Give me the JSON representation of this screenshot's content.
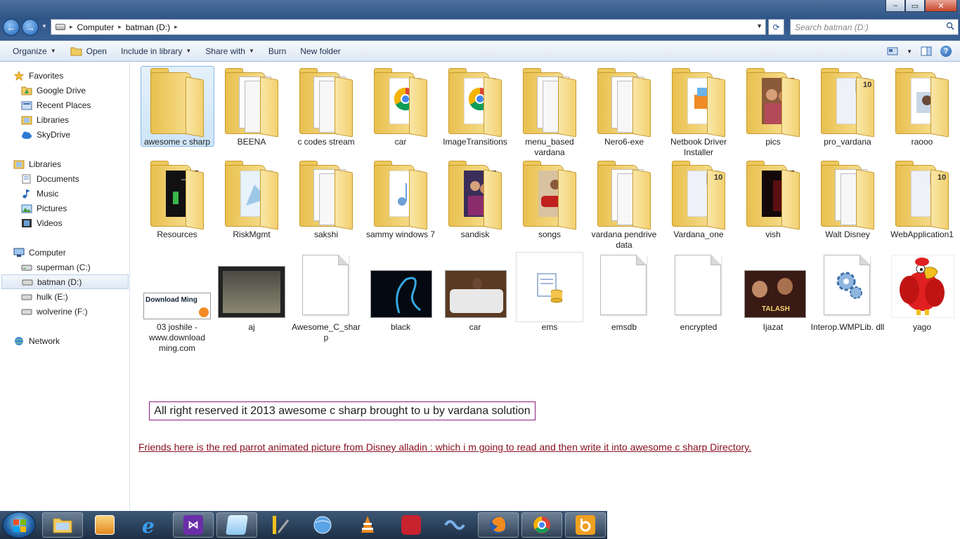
{
  "window": {
    "controls": {
      "minimize": "–",
      "maximize": "▭",
      "close": "✕"
    }
  },
  "address": {
    "crumbs": [
      "Computer",
      "batman (D:)"
    ],
    "search_placeholder": "Search batman (D:)"
  },
  "toolbar": {
    "organize": "Organize",
    "open": "Open",
    "include": "Include in library",
    "share": "Share with",
    "burn": "Burn",
    "new_folder": "New folder",
    "help": "?"
  },
  "sidebar": {
    "favorites": {
      "label": "Favorites",
      "items": [
        "Google Drive",
        "Recent Places",
        "Libraries",
        "SkyDrive"
      ]
    },
    "libraries": {
      "label": "Libraries",
      "items": [
        "Documents",
        "Music",
        "Pictures",
        "Videos"
      ]
    },
    "computer": {
      "label": "Computer",
      "items": [
        "superman (C:)",
        "batman (D:)",
        "hulk (E:)",
        "wolverine (F:)"
      ]
    },
    "network": {
      "label": "Network"
    }
  },
  "items": {
    "row1": [
      "awesome c sharp",
      "BEENA",
      "c codes stream",
      "car",
      "ImageTransitions",
      "menu_based vardana",
      "Nero6-exe",
      "Netbook Driver Installer",
      "pics",
      "pro_vardana",
      "raooo"
    ],
    "row2": [
      "Resources",
      "RiskMgmt",
      "sakshi",
      "sammy windows 7",
      "sandisk",
      "songs",
      "vardana pendrive data",
      "Vardana_one",
      "vish",
      "Walt Disney",
      "WebApplication1"
    ],
    "row3": [
      "03 joshile - www.download ming.com",
      "aj",
      "Awesome_C_shar p",
      "black",
      "car",
      "ems",
      "emsdb",
      "encrypted",
      "Ijazat",
      "Interop.WMPLib. dll",
      "yago"
    ]
  },
  "thumbs": {
    "downloadming": "Download Ming",
    "badge_10": "10",
    "talash": "TALASH"
  },
  "notice": "All right reserved it 2013 awesome c sharp brought to u by vardana solution",
  "friends": "Friends here is the red parrot animated picture from Disney alladin : which i m going to read and then write it into awesome  c  sharp Directory."
}
